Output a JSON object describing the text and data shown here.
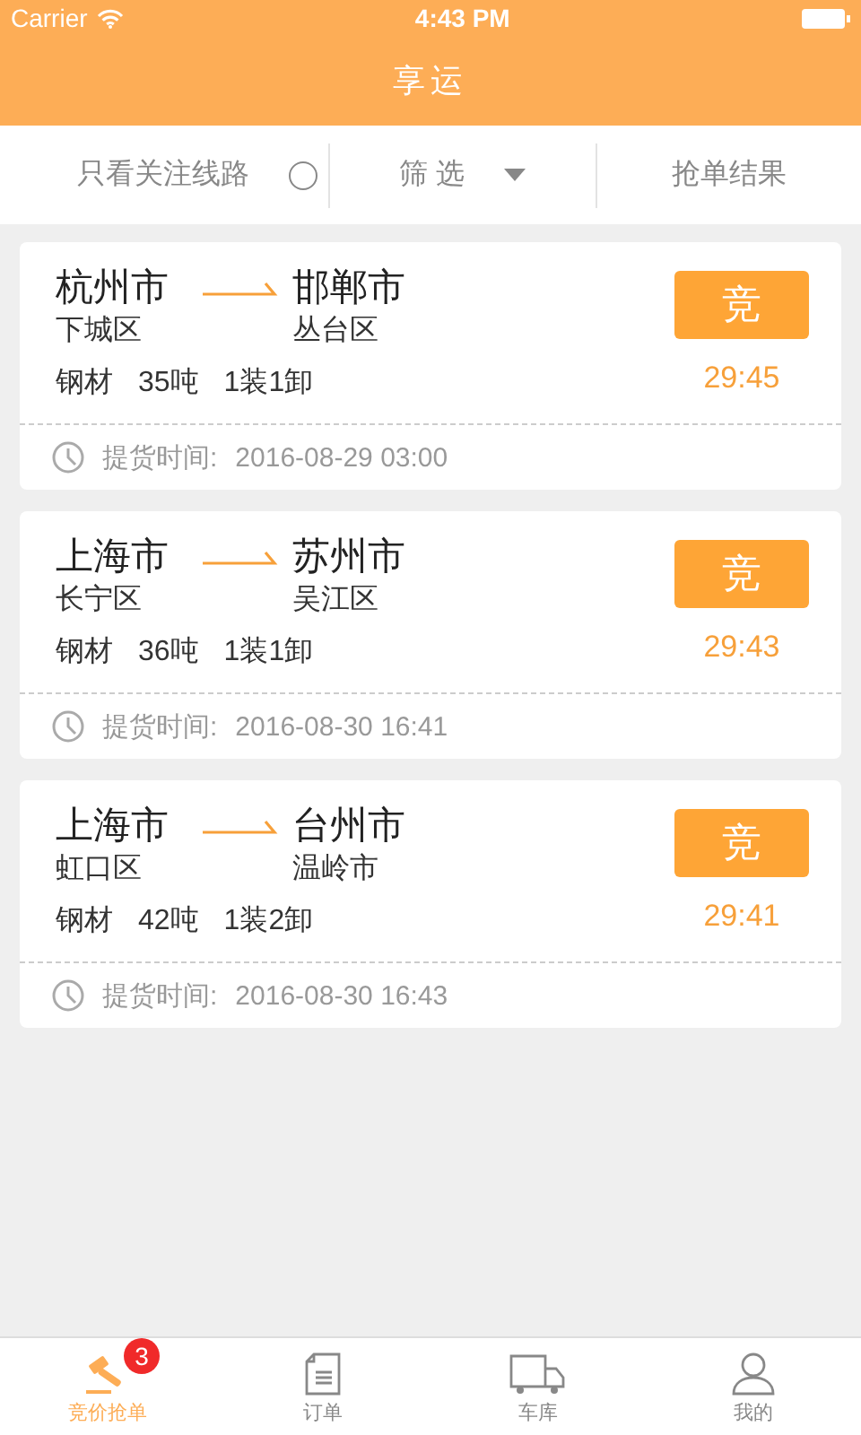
{
  "status_bar": {
    "carrier": "Carrier",
    "time": "4:43 PM"
  },
  "nav": {
    "title": "享运"
  },
  "filters": {
    "watch_label": "只看关注线路",
    "watch_checked": false,
    "filter_label": "筛 选",
    "results_label": "抢单结果"
  },
  "orders": [
    {
      "from_city": "杭州市",
      "from_district": "下城区",
      "to_city": "邯郸市",
      "to_district": "丛台区",
      "cargo": "钢材",
      "weight": "35吨",
      "loading": "1装1卸",
      "action": "竞",
      "countdown": "29:45",
      "pickup_label": "提货时间:",
      "pickup_time": "2016-08-29 03:00"
    },
    {
      "from_city": "上海市",
      "from_district": "长宁区",
      "to_city": "苏州市",
      "to_district": "吴江区",
      "cargo": "钢材",
      "weight": "36吨",
      "loading": "1装1卸",
      "action": "竞",
      "countdown": "29:43",
      "pickup_label": "提货时间:",
      "pickup_time": "2016-08-30 16:41"
    },
    {
      "from_city": "上海市",
      "from_district": "虹口区",
      "to_city": "台州市",
      "to_district": "温岭市",
      "cargo": "钢材",
      "weight": "42吨",
      "loading": "1装2卸",
      "action": "竞",
      "countdown": "29:41",
      "pickup_label": "提货时间:",
      "pickup_time": "2016-08-30 16:43"
    }
  ],
  "tabs": [
    {
      "kind": "gavel",
      "label": "竞价抢单",
      "selected": true,
      "badge": "3"
    },
    {
      "kind": "document",
      "label": "订单",
      "selected": false
    },
    {
      "kind": "truck",
      "label": "车库",
      "selected": false
    },
    {
      "kind": "person",
      "label": "我的",
      "selected": false
    }
  ]
}
